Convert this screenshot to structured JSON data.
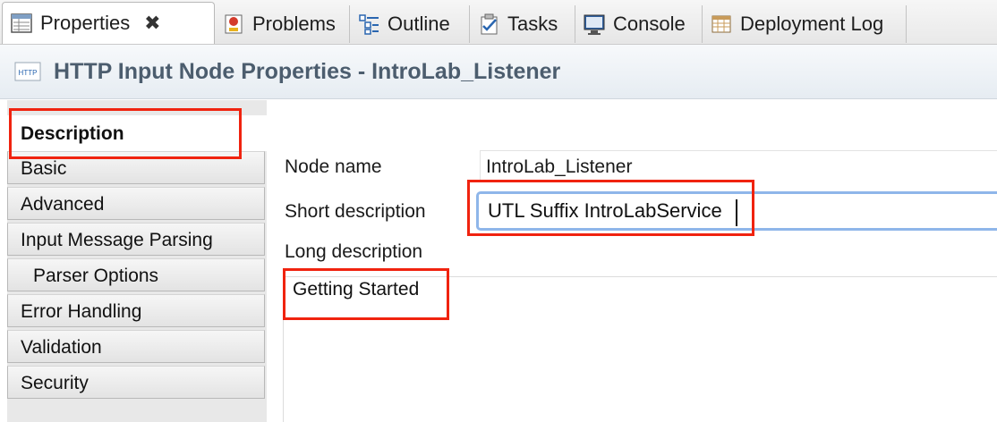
{
  "tabs": [
    {
      "label": "Properties",
      "icon": "properties-icon",
      "active": true,
      "closable": true
    },
    {
      "label": "Problems",
      "icon": "problems-icon"
    },
    {
      "label": "Outline",
      "icon": "outline-icon"
    },
    {
      "label": "Tasks",
      "icon": "tasks-icon"
    },
    {
      "label": "Console",
      "icon": "console-icon"
    },
    {
      "label": "Deployment Log",
      "icon": "deployment-log-icon"
    }
  ],
  "header": {
    "icon_text": "HTTP",
    "title": "HTTP Input Node Properties - IntroLab_Listener"
  },
  "sections": [
    {
      "label": "Description",
      "selected": true
    },
    {
      "label": "Basic"
    },
    {
      "label": "Advanced"
    },
    {
      "label": "Input Message Parsing"
    },
    {
      "label": "Parser Options",
      "sub": true
    },
    {
      "label": "Error Handling"
    },
    {
      "label": "Validation"
    },
    {
      "label": "Security"
    }
  ],
  "form": {
    "node_name_label": "Node name",
    "node_name_value": "IntroLab_Listener",
    "short_desc_label": "Short description",
    "short_desc_value": "UTL Suffix IntroLabService",
    "long_desc_label": "Long description",
    "long_desc_value": "Getting Started"
  },
  "colors": {
    "highlight": "#f0230f",
    "header_title": "#4c5d6e",
    "focus_border": "#8fb6ea"
  }
}
